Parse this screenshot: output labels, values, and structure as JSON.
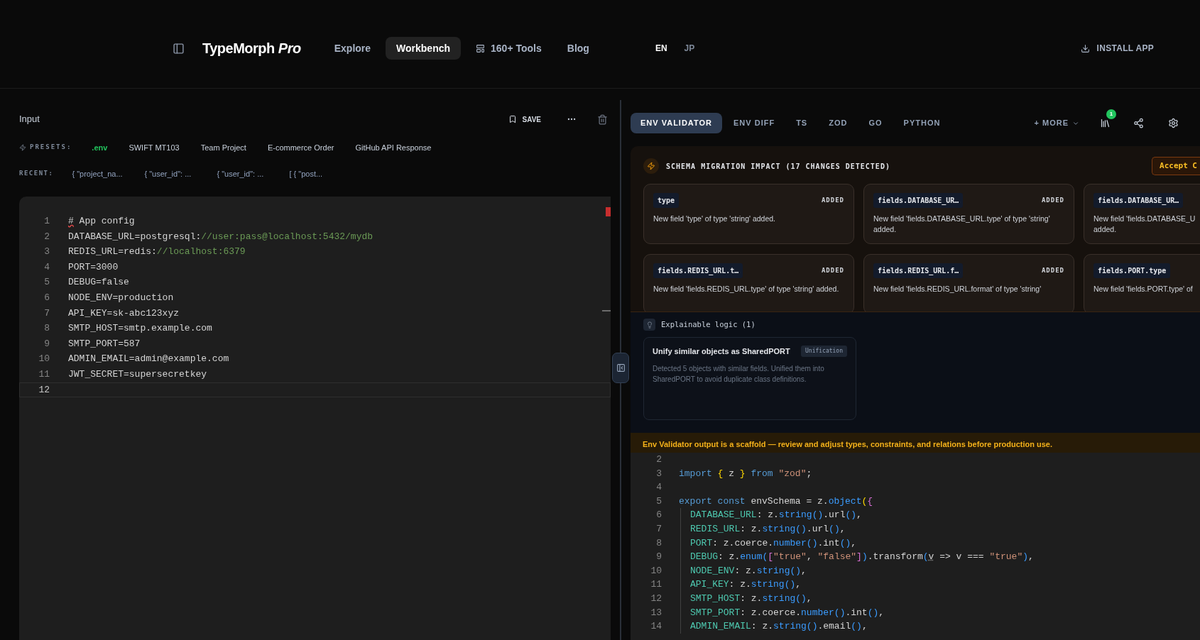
{
  "header": {
    "brand": "TypeMorph",
    "brand_suffix": "Pro",
    "nav": [
      {
        "label": "Explore",
        "selected": false,
        "kind": "link"
      },
      {
        "label": "Workbench",
        "selected": true,
        "kind": "link"
      },
      {
        "label": "160+ Tools",
        "selected": false,
        "kind": "icon-link"
      },
      {
        "label": "Blog",
        "selected": false,
        "kind": "link"
      }
    ],
    "languages": [
      {
        "label": "EN",
        "selected": true
      },
      {
        "label": "JP",
        "selected": false
      }
    ],
    "install": "INSTALL APP"
  },
  "input_panel": {
    "title": "Input",
    "save": "SAVE",
    "presets_label": "PRESETS:",
    "presets": [
      {
        "label": ".env",
        "selected": true
      },
      {
        "label": "SWIFT MT103",
        "selected": false
      },
      {
        "label": "Team Project",
        "selected": false
      },
      {
        "label": "E-commerce Order",
        "selected": false
      },
      {
        "label": "GitHub API Response",
        "selected": false
      }
    ],
    "recent_label": "RECENT:",
    "recent": [
      "{ \"project_na...",
      "{ \"user_id\": ...",
      "{ \"user_id\": ...",
      "[ { \"post..."
    ],
    "editor": [
      {
        "number": "1",
        "selected": false,
        "tokens": [
          {
            "text": "#",
            "kind": "error"
          },
          {
            "text": " App config",
            "kind": "plain"
          }
        ]
      },
      {
        "number": "2",
        "selected": false,
        "tokens": [
          {
            "text": "DATABASE_URL=postgresql:",
            "kind": "plain"
          },
          {
            "text": "//user:pass@localhost:5432/mydb",
            "kind": "comment"
          }
        ]
      },
      {
        "number": "3",
        "selected": false,
        "tokens": [
          {
            "text": "REDIS_URL=redis:",
            "kind": "plain"
          },
          {
            "text": "//localhost:6379",
            "kind": "comment"
          }
        ]
      },
      {
        "number": "4",
        "selected": false,
        "tokens": [
          {
            "text": "PORT=3000",
            "kind": "plain"
          }
        ]
      },
      {
        "number": "5",
        "selected": false,
        "tokens": [
          {
            "text": "DEBUG=false",
            "kind": "plain"
          }
        ]
      },
      {
        "number": "6",
        "selected": false,
        "tokens": [
          {
            "text": "NODE_ENV=production",
            "kind": "plain"
          }
        ]
      },
      {
        "number": "7",
        "selected": false,
        "tokens": [
          {
            "text": "API_KEY=sk-abc123xyz",
            "kind": "plain"
          }
        ]
      },
      {
        "number": "8",
        "selected": false,
        "tokens": [
          {
            "text": "SMTP_HOST=smtp.example.com",
            "kind": "plain"
          }
        ]
      },
      {
        "number": "9",
        "selected": false,
        "tokens": [
          {
            "text": "SMTP_PORT=587",
            "kind": "plain"
          }
        ]
      },
      {
        "number": "10",
        "selected": false,
        "tokens": [
          {
            "text": "ADMIN_EMAIL=admin@example.com",
            "kind": "plain"
          }
        ]
      },
      {
        "number": "11",
        "selected": false,
        "tokens": [
          {
            "text": "JWT_SECRET=supersecretkey",
            "kind": "plain"
          }
        ]
      },
      {
        "number": "12",
        "selected": true
      }
    ]
  },
  "output_panel": {
    "tabs": [
      {
        "label": "ENV VALIDATOR",
        "selected": true
      },
      {
        "label": "ENV DIFF",
        "selected": false
      },
      {
        "label": "TS",
        "selected": false
      },
      {
        "label": "ZOD",
        "selected": false
      },
      {
        "label": "GO",
        "selected": false
      },
      {
        "label": "PYTHON",
        "selected": false
      }
    ],
    "more": "+ MORE",
    "library_badge": "1",
    "migration": {
      "title": "SCHEMA MIGRATION IMPACT (17 CHANGES DETECTED)",
      "accept": "Accept C",
      "changes": [
        {
          "field": "type",
          "status": "ADDED",
          "description": "New field 'type' of type 'string' added."
        },
        {
          "field": "fields.DATABASE_UR…",
          "status": "ADDED",
          "description": "New field 'fields.DATABASE_URL.type' of type 'string'\nadded."
        },
        {
          "field": "fields.DATABASE_UR…",
          "description": "New field 'fields.DATABASE_U\nadded."
        },
        {
          "field": "fields.REDIS_URL.t…",
          "status": "ADDED",
          "description": "New field 'fields.REDIS_URL.type' of type 'string' added."
        },
        {
          "field": "fields.REDIS_URL.f…",
          "status": "ADDED",
          "description": "New field 'fields.REDIS_URL.format' of type 'string'"
        },
        {
          "field": "fields.PORT.type",
          "description": "New field 'fields.PORT.type' of"
        }
      ]
    },
    "logic": {
      "title": "Explainable logic (1)",
      "items": [
        {
          "title": "Unify similar objects as SharedPORT",
          "tag": "Unification",
          "description": "Detected 5 objects with similar fields. Unified them into SharedPORT to avoid duplicate class definitions."
        }
      ]
    },
    "warning": "Env Validator output is a scaffold — review and adjust types, constraints, and relations before production use.",
    "code": [
      {
        "number": "2",
        "indented": false
      },
      {
        "number": "3",
        "indented": false,
        "tokens": [
          {
            "text": "import",
            "kind": "keyword"
          },
          {
            "text": " {",
            "kind": "bracket"
          },
          {
            "text": " z ",
            "kind": "plain"
          },
          {
            "text": "}",
            "kind": "bracket"
          },
          {
            "text": " from ",
            "kind": "keyword"
          },
          {
            "text": "\"zod\"",
            "kind": "string"
          },
          {
            "text": ";",
            "kind": "plain"
          }
        ]
      },
      {
        "number": "4",
        "indented": false
      },
      {
        "number": "5",
        "indented": false,
        "tokens": [
          {
            "text": "export const",
            "kind": "keyword"
          },
          {
            "text": " envSchema = z.",
            "kind": "plain"
          },
          {
            "text": "object",
            "kind": "func"
          },
          {
            "text": "(",
            "kind": "bracket"
          },
          {
            "text": "{",
            "kind": "bracket2"
          }
        ]
      },
      {
        "number": "6",
        "indented": true,
        "tokens": [
          {
            "text": "DATABASE_URL",
            "kind": "property"
          },
          {
            "text": ": z.",
            "kind": "plain"
          },
          {
            "text": "string()",
            "kind": "func"
          },
          {
            "text": ".url",
            "kind": "plain"
          },
          {
            "text": "()",
            "kind": "func"
          },
          {
            "text": ",",
            "kind": "plain"
          }
        ]
      },
      {
        "number": "7",
        "indented": true,
        "tokens": [
          {
            "text": "REDIS_URL",
            "kind": "property"
          },
          {
            "text": ": z.",
            "kind": "plain"
          },
          {
            "text": "string()",
            "kind": "func"
          },
          {
            "text": ".url",
            "kind": "plain"
          },
          {
            "text": "()",
            "kind": "func"
          },
          {
            "text": ",",
            "kind": "plain"
          }
        ]
      },
      {
        "number": "8",
        "indented": true,
        "tokens": [
          {
            "text": "PORT",
            "kind": "property"
          },
          {
            "text": ": z.coerce.",
            "kind": "plain"
          },
          {
            "text": "number()",
            "kind": "func"
          },
          {
            "text": ".int",
            "kind": "plain"
          },
          {
            "text": "()",
            "kind": "func"
          },
          {
            "text": ",",
            "kind": "plain"
          }
        ]
      },
      {
        "number": "9",
        "indented": true,
        "tokens": [
          {
            "text": "DEBUG",
            "kind": "property"
          },
          {
            "text": ": z.",
            "kind": "plain"
          },
          {
            "text": "enum(",
            "kind": "func"
          },
          {
            "text": "[",
            "kind": "bracket2"
          },
          {
            "text": "\"true\"",
            "kind": "string"
          },
          {
            "text": ", ",
            "kind": "plain"
          },
          {
            "text": "\"false\"",
            "kind": "string"
          },
          {
            "text": "]",
            "kind": "bracket2"
          },
          {
            "text": ")",
            "kind": "func"
          },
          {
            "text": ".transform",
            "kind": "plain"
          },
          {
            "text": "(",
            "kind": "func"
          },
          {
            "text": "v",
            "kind": "param"
          },
          {
            "text": " => v === ",
            "kind": "plain"
          },
          {
            "text": "\"true\"",
            "kind": "string"
          },
          {
            "text": ")",
            "kind": "func"
          },
          {
            "text": ",",
            "kind": "plain"
          }
        ]
      },
      {
        "number": "10",
        "indented": true,
        "tokens": [
          {
            "text": "NODE_ENV",
            "kind": "property"
          },
          {
            "text": ": z.",
            "kind": "plain"
          },
          {
            "text": "string()",
            "kind": "func"
          },
          {
            "text": ",",
            "kind": "plain"
          }
        ]
      },
      {
        "number": "11",
        "indented": true,
        "tokens": [
          {
            "text": "API_KEY",
            "kind": "property"
          },
          {
            "text": ": z.",
            "kind": "plain"
          },
          {
            "text": "string()",
            "kind": "func"
          },
          {
            "text": ",",
            "kind": "plain"
          }
        ]
      },
      {
        "number": "12",
        "indented": true,
        "tokens": [
          {
            "text": "SMTP_HOST",
            "kind": "property"
          },
          {
            "text": ": z.",
            "kind": "plain"
          },
          {
            "text": "string()",
            "kind": "func"
          },
          {
            "text": ",",
            "kind": "plain"
          }
        ]
      },
      {
        "number": "13",
        "indented": true,
        "tokens": [
          {
            "text": "SMTP_PORT",
            "kind": "property"
          },
          {
            "text": ": z.coerce.",
            "kind": "plain"
          },
          {
            "text": "number()",
            "kind": "func"
          },
          {
            "text": ".int",
            "kind": "plain"
          },
          {
            "text": "()",
            "kind": "func"
          },
          {
            "text": ",",
            "kind": "plain"
          }
        ]
      },
      {
        "number": "14",
        "indented": true,
        "tokens": [
          {
            "text": "ADMIN_EMAIL",
            "kind": "property"
          },
          {
            "text": ": z.",
            "kind": "plain"
          },
          {
            "text": "string()",
            "kind": "func"
          },
          {
            "text": ".email",
            "kind": "plain"
          },
          {
            "text": "()",
            "kind": "func"
          },
          {
            "text": ",",
            "kind": "plain"
          }
        ]
      }
    ]
  }
}
